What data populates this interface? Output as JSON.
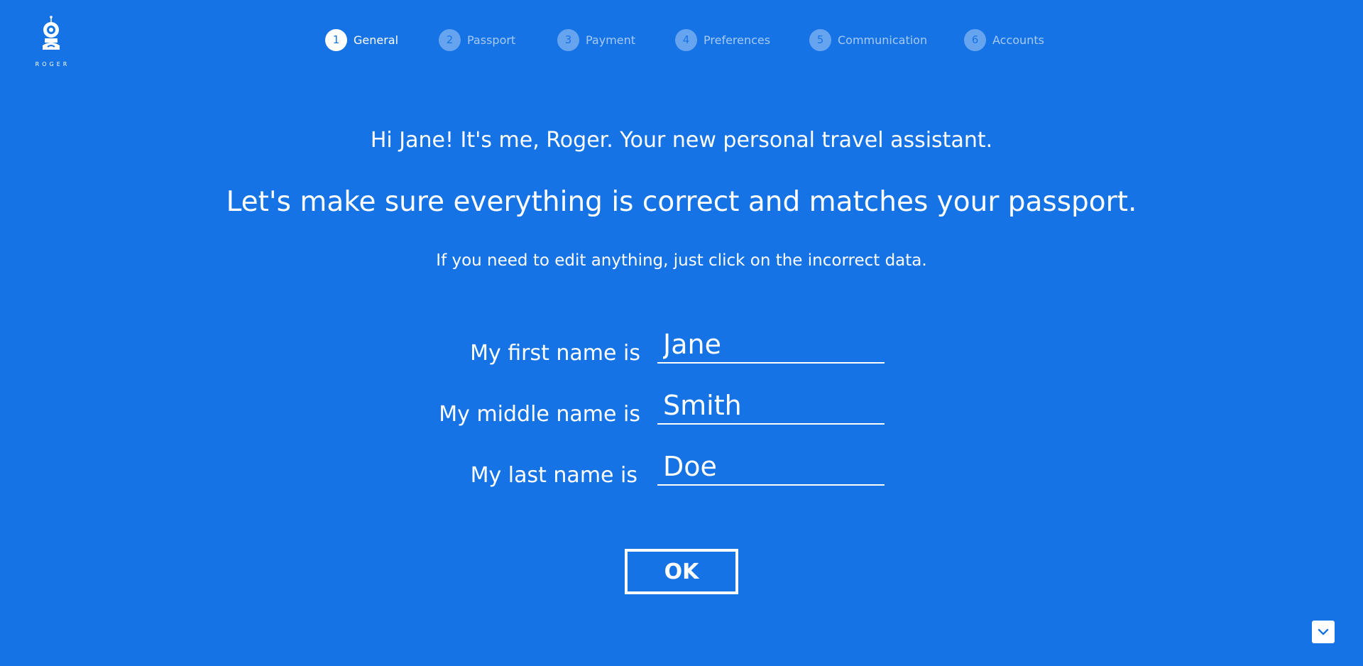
{
  "logo": {
    "text": "ROGER",
    "icon": "robot-icon"
  },
  "stepper": {
    "steps": [
      {
        "number": "1",
        "label": "General",
        "active": true
      },
      {
        "number": "2",
        "label": "Passport",
        "active": false
      },
      {
        "number": "3",
        "label": "Payment",
        "active": false
      },
      {
        "number": "4",
        "label": "Preferences",
        "active": false
      },
      {
        "number": "5",
        "label": "Communication",
        "active": false
      },
      {
        "number": "6",
        "label": "Accounts",
        "active": false
      }
    ]
  },
  "intro": {
    "greeting": "Hi Jane! It's me, Roger. Your new personal travel assistant.",
    "headline": "Let's make sure everything is correct and matches your passport.",
    "instruction": "If you need to edit anything, just click on the incorrect data."
  },
  "form": {
    "first_name_label": "My first name is",
    "first_name_value": "Jane",
    "middle_name_label": "My middle name is",
    "middle_name_value": "Smith",
    "last_name_label": "My last name is",
    "last_name_value": "Doe"
  },
  "actions": {
    "ok_label": "OK",
    "scroll_icon": "chevron-down-icon"
  },
  "colors": {
    "background": "#1673e6",
    "foreground": "#ffffff"
  }
}
